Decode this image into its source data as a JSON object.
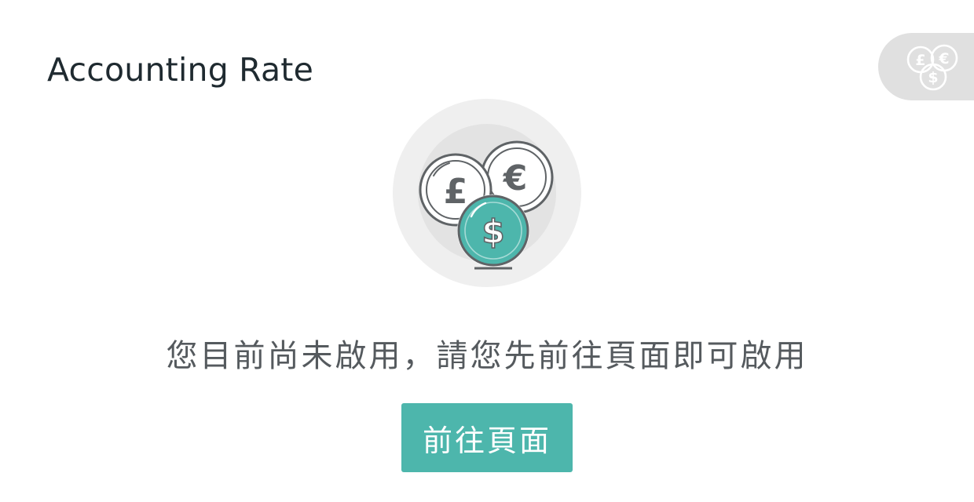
{
  "header": {
    "title": "Accounting Rate"
  },
  "corner_action": {
    "icon": "currency-coins-icon"
  },
  "illustration": {
    "icon": "currency-coins-icon",
    "symbols": {
      "pound": "£",
      "euro": "€",
      "dollar": "$"
    }
  },
  "empty_state": {
    "message": "您目前尚未啟用，請您先前往頁面即可啟用",
    "button_label": "前往頁面"
  },
  "colors": {
    "accent": "#4db6ac",
    "coin_stroke": "#5f6366",
    "halo_outer": "#efefef",
    "halo_inner": "#e3e3e3",
    "corner_tab_bg": "#e0e0e0"
  }
}
